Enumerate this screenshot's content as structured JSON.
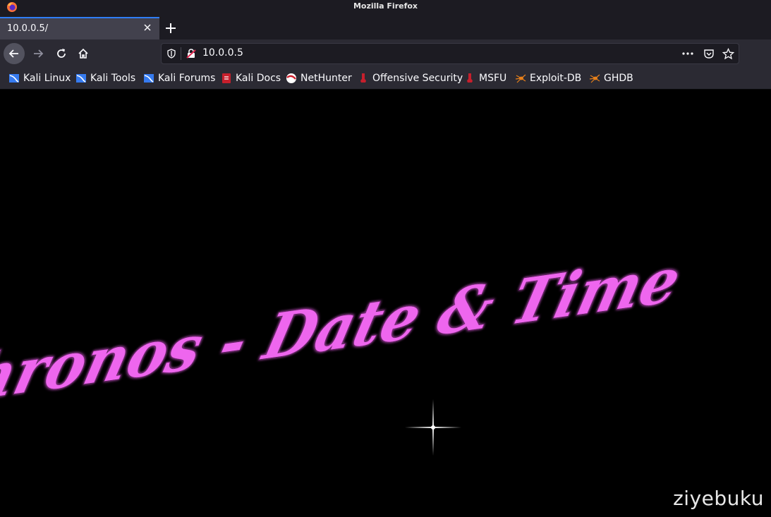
{
  "window": {
    "title": "Mozilla Firefox"
  },
  "tabs": [
    {
      "label": "10.0.0.5/",
      "active": true
    }
  ],
  "navbar": {
    "url": "10.0.0.5"
  },
  "bookmarks": [
    {
      "label": "Kali Linux",
      "icon": "kali-dragon-icon"
    },
    {
      "label": "Kali Tools",
      "icon": "kali-dragon-icon"
    },
    {
      "label": "Kali Forums",
      "icon": "kali-dragon-icon"
    },
    {
      "label": "Kali Docs",
      "icon": "kali-docs-icon"
    },
    {
      "label": "NetHunter",
      "icon": "nethunter-icon"
    },
    {
      "label": "Offensive Security",
      "icon": "offsec-icon"
    },
    {
      "label": "MSFU",
      "icon": "offsec-icon"
    },
    {
      "label": "Exploit-DB",
      "icon": "exploitdb-spider-icon"
    },
    {
      "label": "GHDB",
      "icon": "exploitdb-spider-icon"
    }
  ],
  "page": {
    "heading": "Chronos - Date & Time",
    "heading_color": "#ee66ee",
    "background": "#000000"
  },
  "watermark": "ziyebuku",
  "colors": {
    "accent": "#2f7df6",
    "chrome_dark": "#1c1b22",
    "chrome": "#2b2a33",
    "tab_active": "#42414d"
  }
}
